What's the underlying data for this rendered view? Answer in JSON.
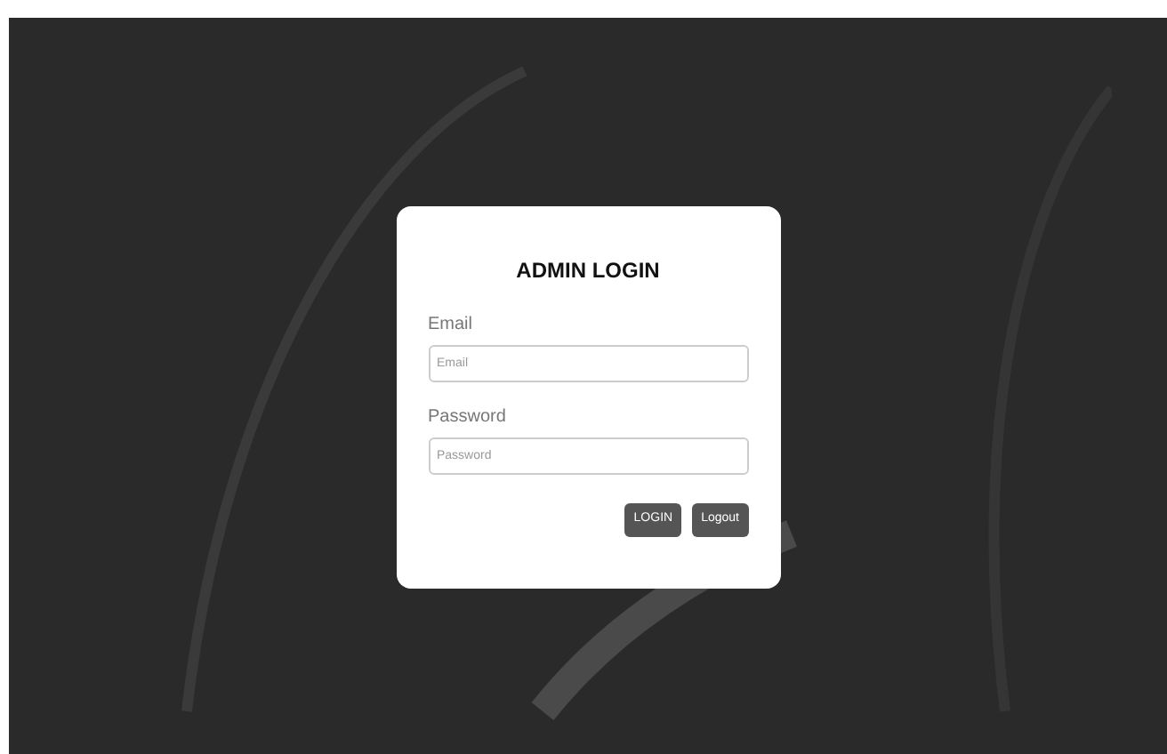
{
  "title": "ADMIN LOGIN",
  "fields": [
    {
      "label": "Email",
      "placeholder": "Email"
    },
    {
      "label": "Password",
      "placeholder": "Password"
    }
  ],
  "buttons": [
    "LOGIN",
    "Logout"
  ]
}
